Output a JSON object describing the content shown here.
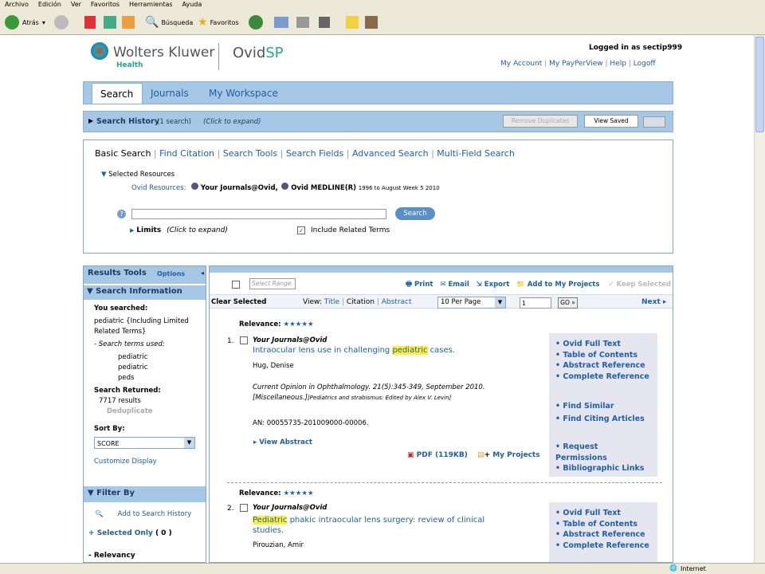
{
  "browser": {
    "menu": [
      "Archivo",
      "Edición",
      "Ver",
      "Favoritos",
      "Herramientas",
      "Ayuda"
    ],
    "back": "Atrás",
    "search": "Búsqueda",
    "favorites": "Favoritos",
    "zone": "Internet"
  },
  "header": {
    "brand": "Wolters Kluwer",
    "brand_sub": "Health",
    "product_a": "Ovid",
    "product_b": "SP",
    "logged_in": "Logged in as sectip999",
    "links": [
      "My Account",
      "My PayPerView",
      "Help",
      "Logoff"
    ]
  },
  "tabs": [
    "Search",
    "Journals",
    "My Workspace"
  ],
  "history": {
    "label": "Search History",
    "count": "(1 search)",
    "hint": "(Click to expand)",
    "remove": "Remove Duplicates",
    "view_saved": "View Saved"
  },
  "search": {
    "modes": [
      "Basic Search",
      "Find Citation",
      "Search Tools",
      "Search Fields",
      "Advanced Search",
      "Multi-Field Search"
    ],
    "selected": "Selected Resources",
    "resources_label": "Ovid Resources:",
    "res1": "Your Journals@Ovid,",
    "res2": "Ovid MEDLINE(R)",
    "res2_range": "1996 to August Week 5 2010",
    "button": "Search",
    "limits": "Limits",
    "limits_hint": "(Click to expand)",
    "related": "Include Related Terms",
    "query": ""
  },
  "left": {
    "tools": "Results Tools",
    "options": "Options",
    "info": "Search Information",
    "you_searched": "You searched:",
    "query": "pediatric {Including Limited Related Terms}",
    "terms_used": "Search terms used:",
    "terms": [
      "pediatric",
      "pediatric",
      "peds"
    ],
    "returned": "Search Returned:",
    "results": "7717 results",
    "dedup": "Deduplicate",
    "sort_by": "Sort By:",
    "sort_value": "SCORE",
    "customize": "Customize Display",
    "filter": "Filter By",
    "add_history": "Add to Search History",
    "selected_only": "Selected Only",
    "selected_count": "( 0 )",
    "relevancy": "Relevancy"
  },
  "results": {
    "select_range": "Select Range",
    "print": "Print",
    "email": "Email",
    "export": "Export",
    "add_projects": "Add to My Projects",
    "keep": "Keep Selected",
    "clear": "Clear Selected",
    "view": "View:",
    "view_opts": [
      "Title",
      "Citation",
      "Abstract"
    ],
    "per_page": "10 Per Page",
    "page": "1",
    "go": "GO",
    "next": "Next",
    "relevance": "Relevance:",
    "stars": "★★★★★",
    "items": [
      {
        "num": "1.",
        "source": "Your Journals@Ovid",
        "title_pre": "Intraocular lens use in challenging ",
        "title_hl": "pediatric",
        "title_post": " cases.",
        "author": "Hug, Denise",
        "citation": "Current Opinion in Ophthalmology. 21(5):345-349, September 2010.",
        "misc": "[Miscellaneous.]",
        "misc_note": "[Pediatrics and strabismus: Edited by Alex V. Levin]",
        "an": "AN: 00055735-201009000-00006.",
        "view_abstract": "View Abstract",
        "pdf": "PDF (119KB)",
        "my_projects": "My Projects"
      },
      {
        "num": "2.",
        "source": "Your Journals@Ovid",
        "title_hl": "Pediatric",
        "title_post": " phakic intraocular lens surgery: review of clinical studies.",
        "author": "Pirouzian, Amir"
      }
    ],
    "side1": [
      "Ovid Full Text",
      "Table of Contents",
      "Abstract Reference",
      "Complete Reference"
    ],
    "side2": [
      "Find Similar",
      "Find Citing Articles"
    ],
    "side3": [
      "Request Permissions",
      "Bibliographic Links"
    ],
    "side_b": [
      "Ovid Full Text",
      "Table of Contents",
      "Abstract Reference",
      "Complete Reference"
    ]
  }
}
